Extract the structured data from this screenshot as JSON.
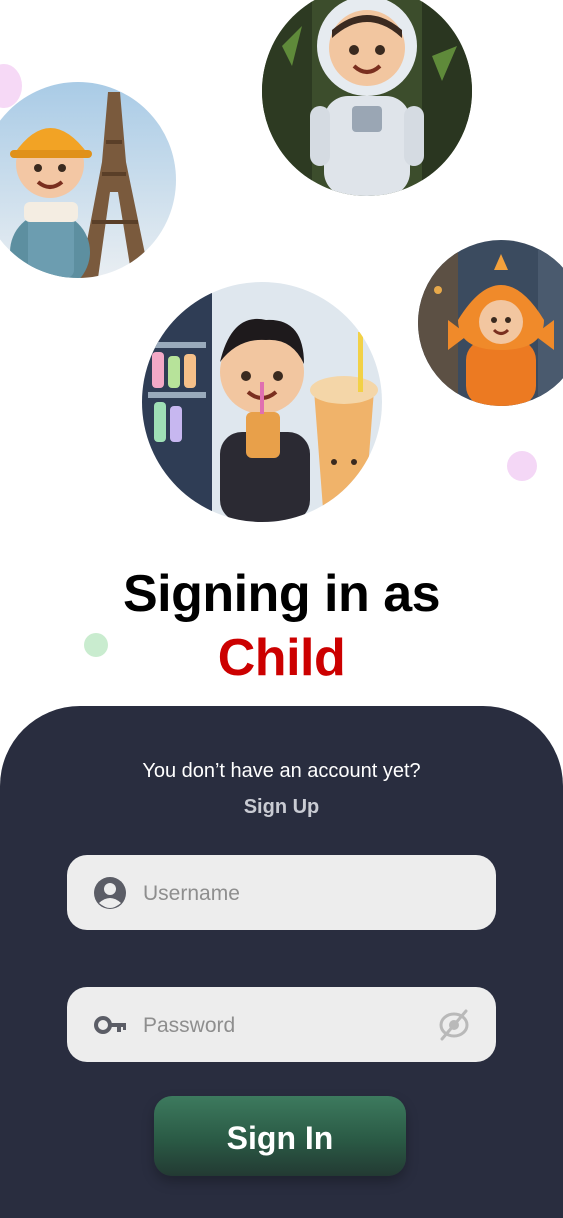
{
  "heading": {
    "line1": "Signing in as",
    "line2": "Child",
    "line2_color": "#cc0000"
  },
  "avatars": [
    {
      "name": "construction-boy-eiffel-tower"
    },
    {
      "name": "astronaut-boy"
    },
    {
      "name": "boy-in-fish-costume"
    },
    {
      "name": "boy-with-bubble-tea"
    }
  ],
  "form": {
    "prompt": "You don’t have an account yet?",
    "signup_label": "Sign Up",
    "username": {
      "placeholder": "Username",
      "value": "",
      "icon": "user-circle-icon"
    },
    "password": {
      "placeholder": "Password",
      "value": "",
      "icon": "key-icon",
      "toggle_icon": "eye-off-icon"
    },
    "signin_label": "Sign In"
  },
  "colors": {
    "panel": "#292d3f",
    "field": "#ededed",
    "button_top": "#3d7a5e",
    "button_bottom": "#233a33",
    "accent_red": "#cc0000",
    "dot_pink": "#f6d9f6",
    "dot_green": "#c9eccf"
  }
}
